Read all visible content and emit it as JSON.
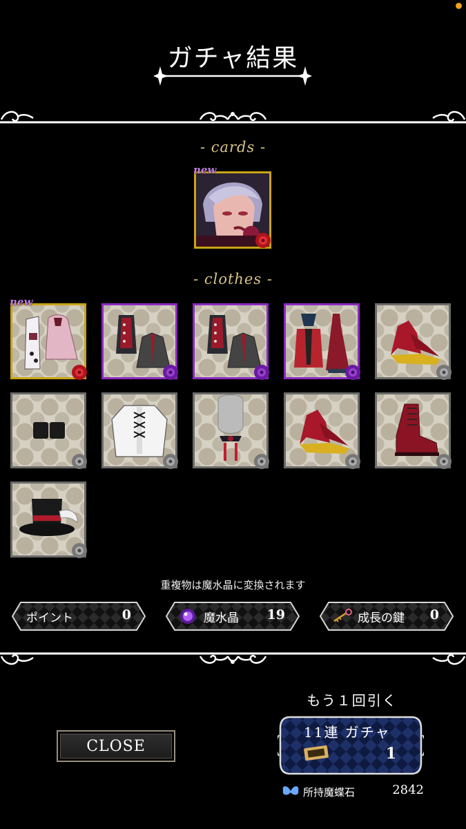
{
  "header": {
    "title": "ガチャ結果"
  },
  "sections": {
    "cards_label": "- cards -",
    "clothes_label": "- clothes -"
  },
  "badges": {
    "new": "new"
  },
  "notice": "重複物は魔水晶に変換されます",
  "counters": [
    {
      "label": "ポイント",
      "value": "0"
    },
    {
      "label": "魔水晶",
      "value": "19"
    },
    {
      "label": "成長の鍵",
      "value": "0"
    }
  ],
  "footer": {
    "close_label": "CLOSE",
    "again_label": "もう１回引く",
    "gacha_label": "11連 ガチャ",
    "ticket_count": "1",
    "owned_label": "所持魔蝶石",
    "owned_value": "2842"
  },
  "colors": {
    "gold": "#c9a415",
    "purple": "#8a2ac0",
    "silver": "#6b6b6b",
    "accent_label": "#d8c38a"
  }
}
